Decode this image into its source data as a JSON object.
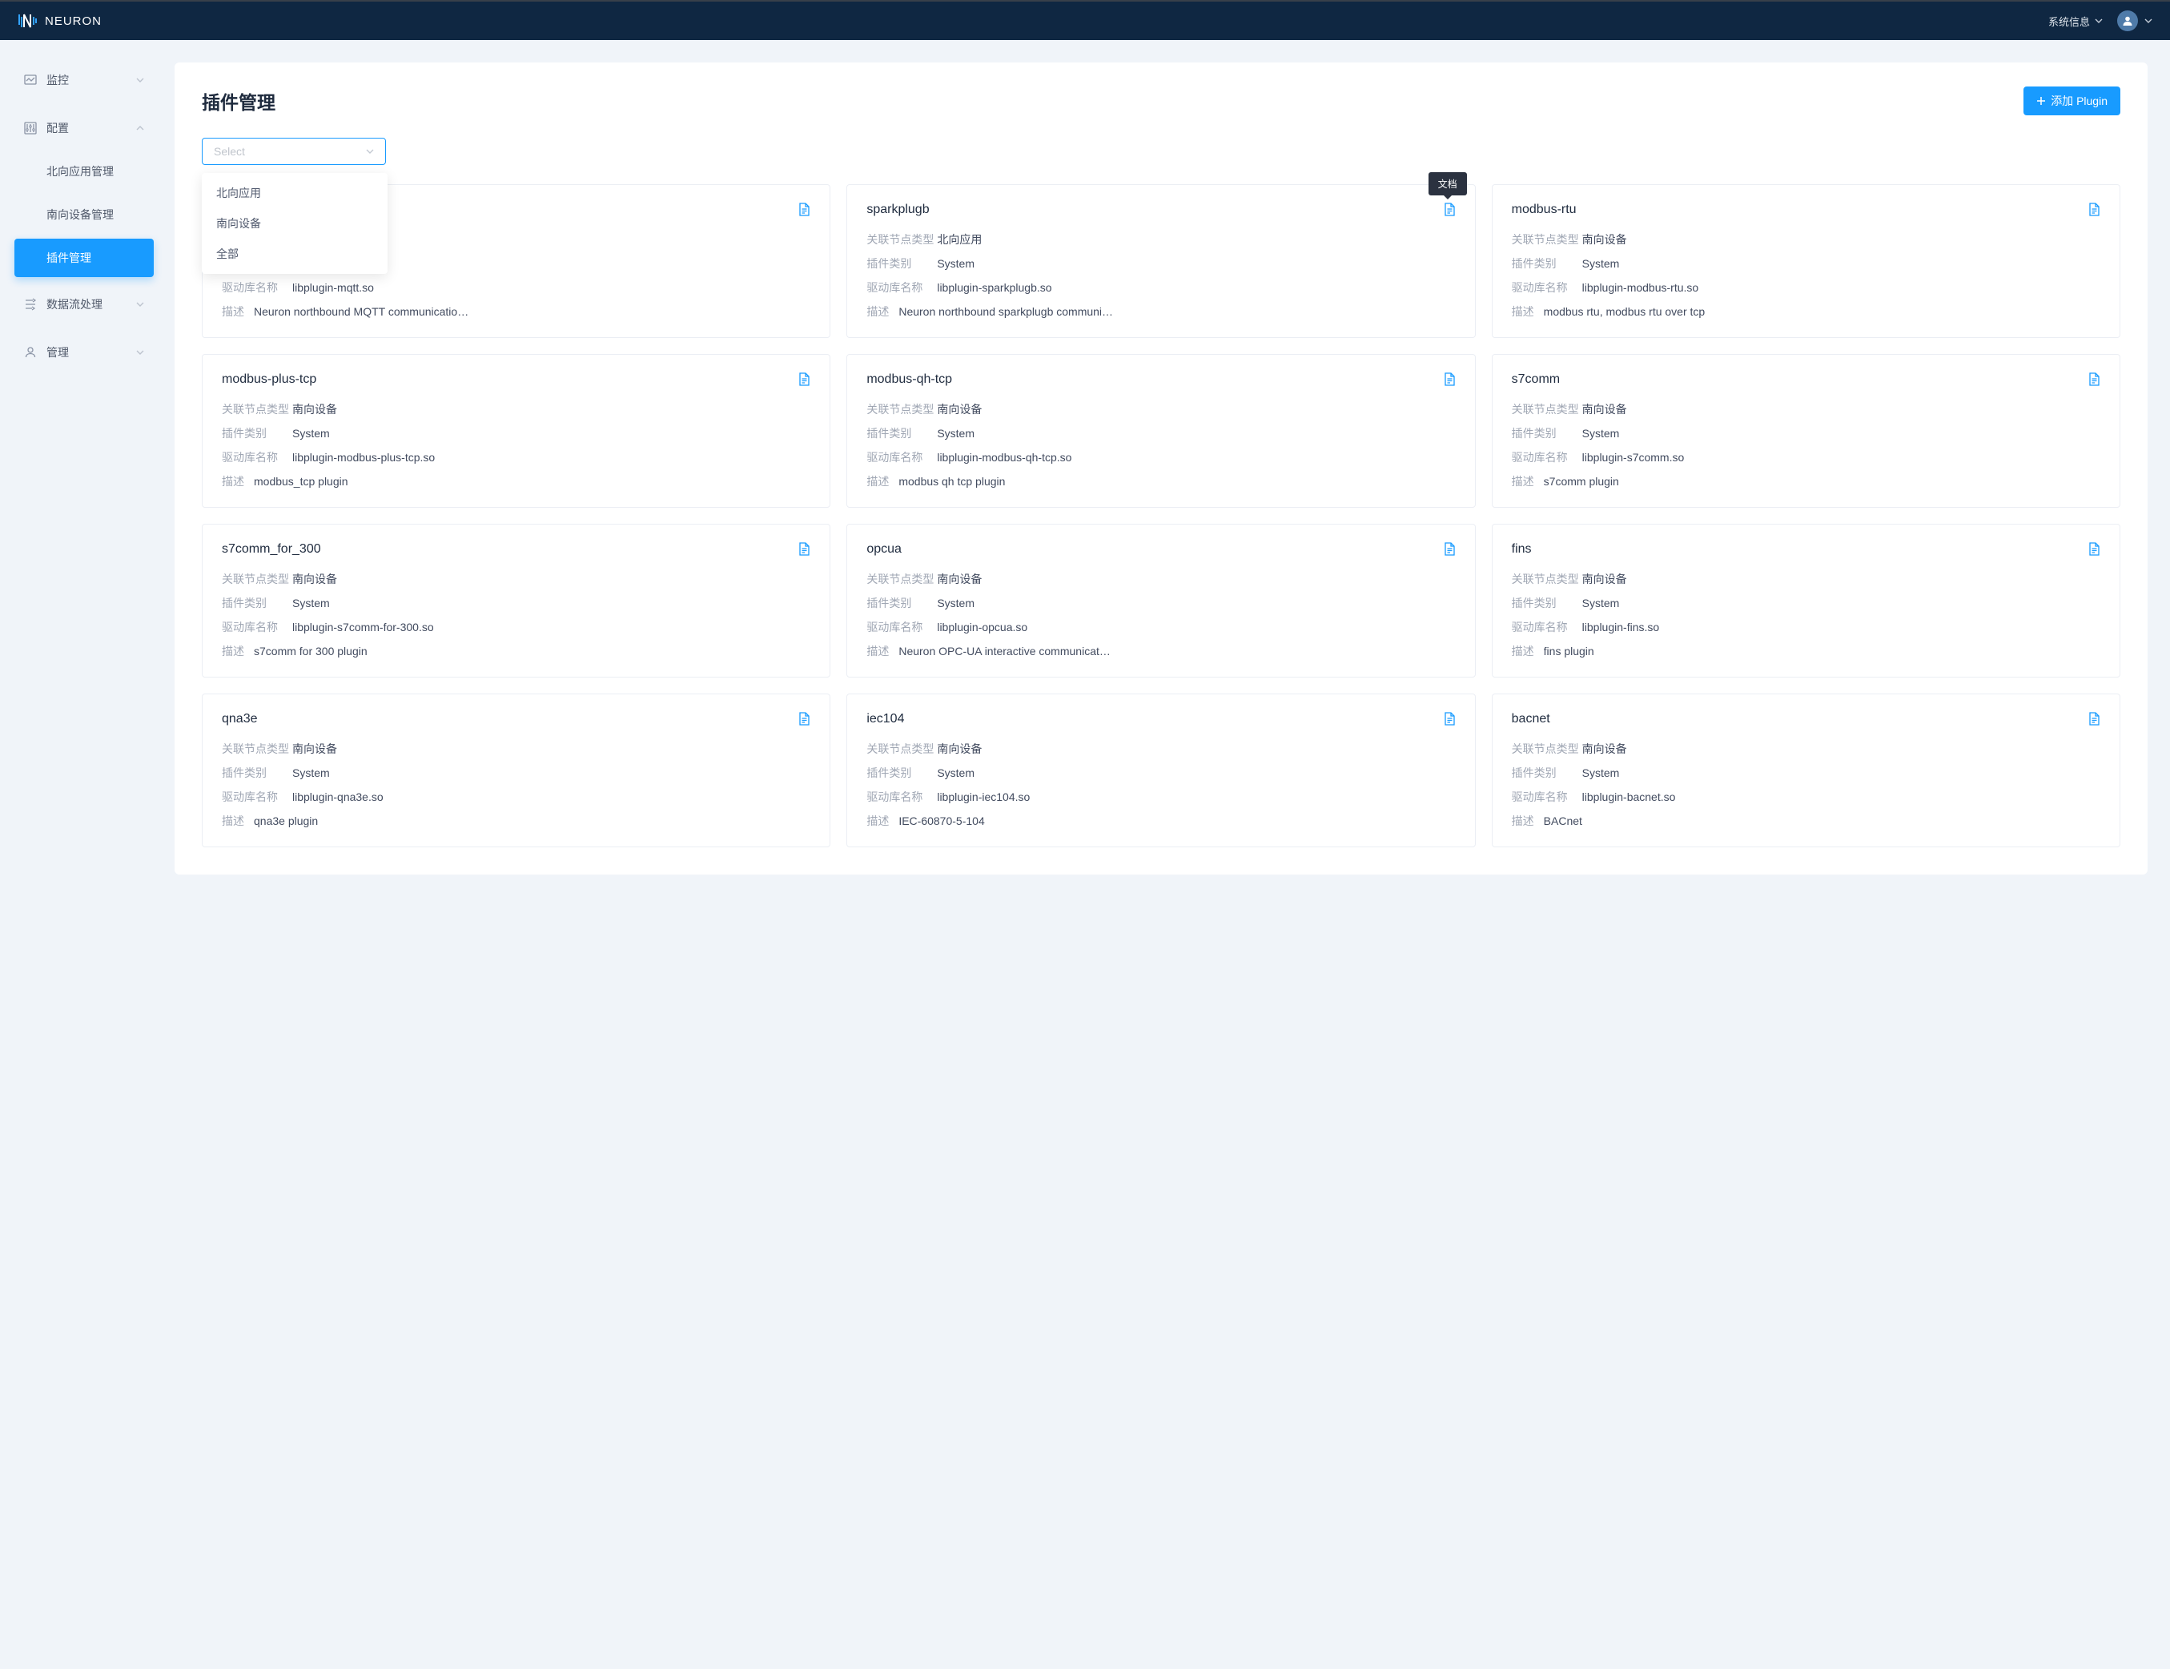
{
  "header": {
    "brand": "NEURON",
    "sys_info": "系统信息"
  },
  "sidebar": {
    "items": [
      {
        "label": "监控",
        "expandable": true,
        "open": false
      },
      {
        "label": "配置",
        "expandable": true,
        "open": true
      },
      {
        "label": "数据流处理",
        "expandable": true,
        "open": false
      },
      {
        "label": "管理",
        "expandable": true,
        "open": false
      }
    ],
    "config_sub": [
      {
        "label": "北向应用管理",
        "active": false
      },
      {
        "label": "南向设备管理",
        "active": false
      },
      {
        "label": "插件管理",
        "active": true
      }
    ]
  },
  "page": {
    "title": "插件管理",
    "add_button": "添加 Plugin",
    "select_placeholder": "Select",
    "dropdown_options": [
      "北向应用",
      "南向设备",
      "全部"
    ],
    "tooltip_doc": "文档",
    "labels": {
      "node_type": "关联节点类型",
      "plugin_kind": "插件类别",
      "lib_name": "驱动库名称",
      "description": "描述"
    }
  },
  "plugins": [
    {
      "name": "",
      "node_type": "",
      "kind": "",
      "lib": "libplugin-mqtt.so",
      "desc": "Neuron northbound MQTT communicatio…",
      "tooltip": false
    },
    {
      "name": "sparkplugb",
      "node_type": "北向应用",
      "kind": "System",
      "lib": "libplugin-sparkplugb.so",
      "desc": "Neuron northbound sparkplugb communi…",
      "tooltip": true
    },
    {
      "name": "modbus-rtu",
      "node_type": "南向设备",
      "kind": "System",
      "lib": "libplugin-modbus-rtu.so",
      "desc": "modbus rtu, modbus rtu over tcp",
      "tooltip": false
    },
    {
      "name": "modbus-plus-tcp",
      "node_type": "南向设备",
      "kind": "System",
      "lib": "libplugin-modbus-plus-tcp.so",
      "desc": "modbus_tcp plugin",
      "tooltip": false
    },
    {
      "name": "modbus-qh-tcp",
      "node_type": "南向设备",
      "kind": "System",
      "lib": "libplugin-modbus-qh-tcp.so",
      "desc": "modbus qh tcp plugin",
      "tooltip": false
    },
    {
      "name": "s7comm",
      "node_type": "南向设备",
      "kind": "System",
      "lib": "libplugin-s7comm.so",
      "desc": "s7comm plugin",
      "tooltip": false
    },
    {
      "name": "s7comm_for_300",
      "node_type": "南向设备",
      "kind": "System",
      "lib": "libplugin-s7comm-for-300.so",
      "desc": "s7comm for 300 plugin",
      "tooltip": false
    },
    {
      "name": "opcua",
      "node_type": "南向设备",
      "kind": "System",
      "lib": "libplugin-opcua.so",
      "desc": "Neuron OPC-UA interactive communicat…",
      "tooltip": false
    },
    {
      "name": "fins",
      "node_type": "南向设备",
      "kind": "System",
      "lib": "libplugin-fins.so",
      "desc": "fins plugin",
      "tooltip": false
    },
    {
      "name": "qna3e",
      "node_type": "南向设备",
      "kind": "System",
      "lib": "libplugin-qna3e.so",
      "desc": "qna3e plugin",
      "tooltip": false
    },
    {
      "name": "iec104",
      "node_type": "南向设备",
      "kind": "System",
      "lib": "libplugin-iec104.so",
      "desc": "IEC-60870-5-104",
      "tooltip": false
    },
    {
      "name": "bacnet",
      "node_type": "南向设备",
      "kind": "System",
      "lib": "libplugin-bacnet.so",
      "desc": "BACnet",
      "tooltip": false
    }
  ]
}
